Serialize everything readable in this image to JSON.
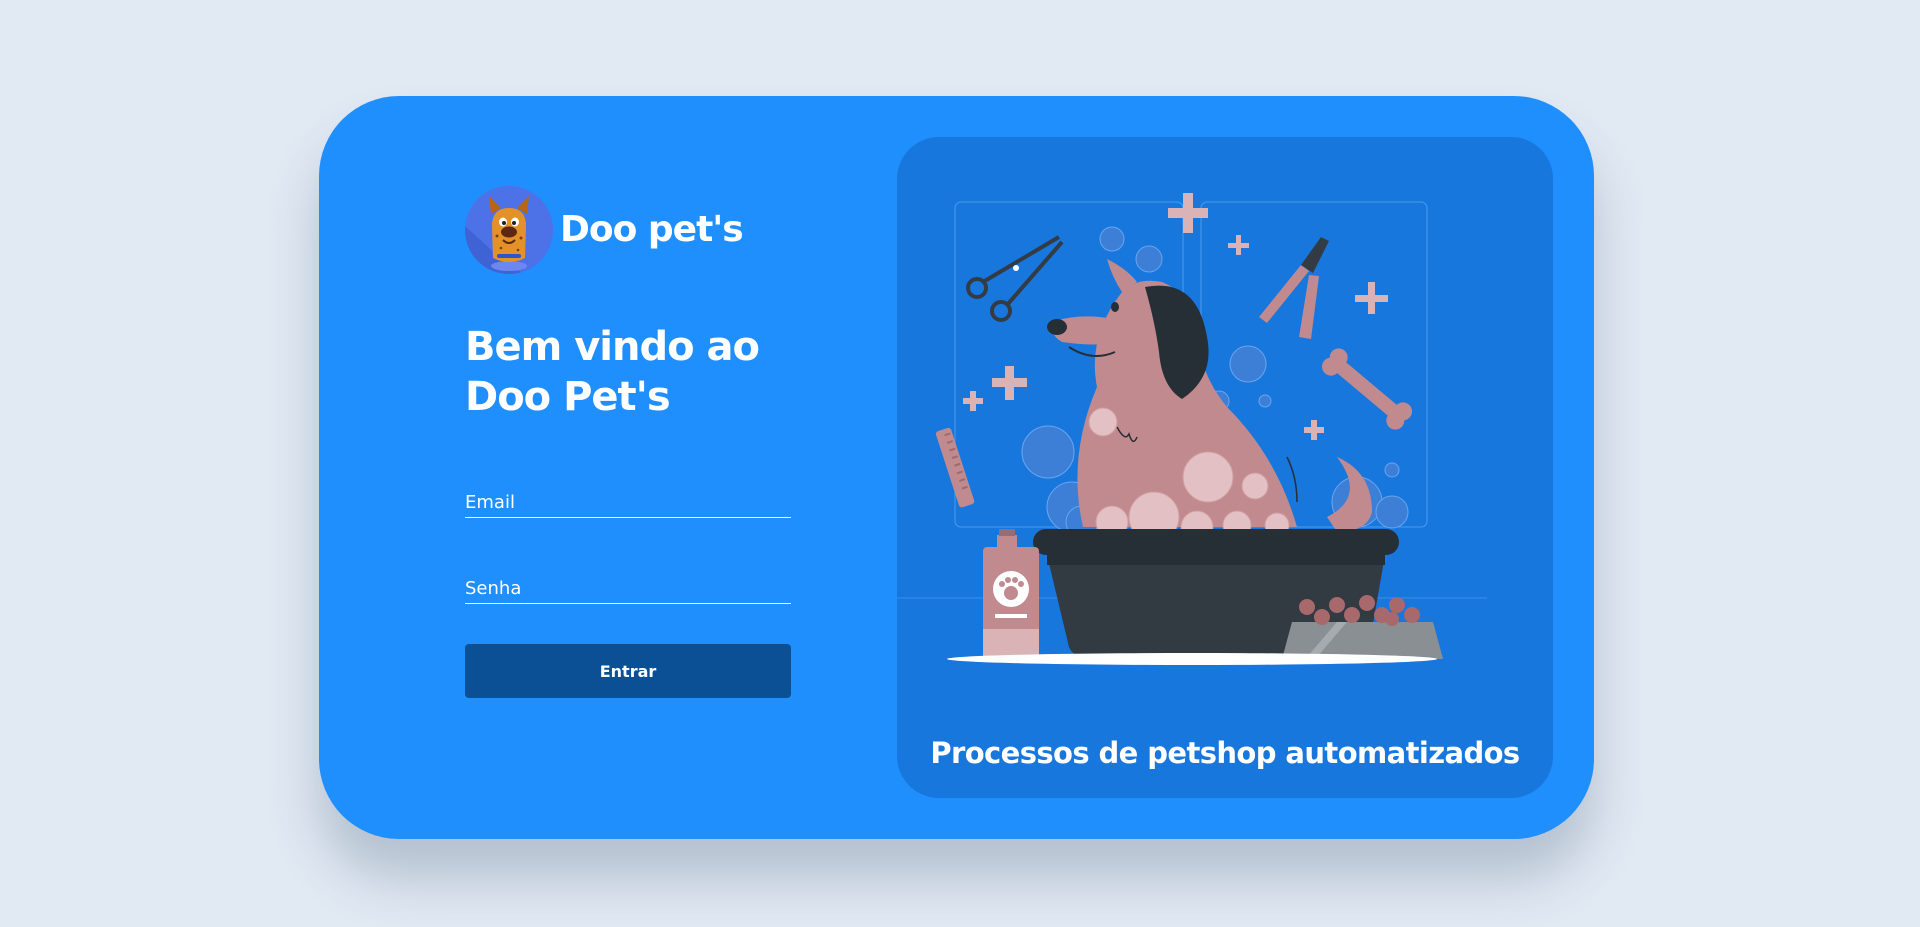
{
  "brand": {
    "name": "Doo pet's",
    "logo_icon": "dog-face-icon"
  },
  "welcome": {
    "line1": "Bem vindo ao",
    "line2": "Doo Pet's"
  },
  "form": {
    "email_placeholder": "Email",
    "password_placeholder": "Senha",
    "submit_label": "Entrar"
  },
  "illustration": {
    "icon": "dog-bath-illustration",
    "caption": "Processos de petshop automatizados"
  },
  "colors": {
    "background": "#e1e9f3",
    "card": "#1e8ffd",
    "panel": "#1877dd",
    "button": "#0b4f95"
  }
}
